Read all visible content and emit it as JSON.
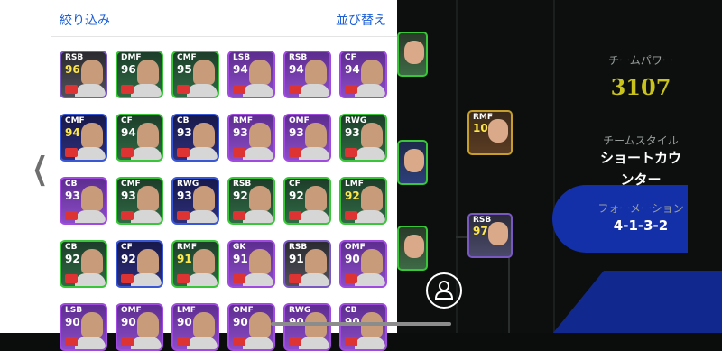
{
  "header": {
    "filter_label": "絞り込み",
    "sort_label": "並び替え"
  },
  "cards": [
    {
      "pos": "RSB",
      "ovr": "96",
      "style": "c-dark",
      "gold": true
    },
    {
      "pos": "DMF",
      "ovr": "96",
      "style": "c-green",
      "gold": false
    },
    {
      "pos": "CMF",
      "ovr": "95",
      "style": "c-green",
      "gold": false
    },
    {
      "pos": "LSB",
      "ovr": "94",
      "style": "c-purple",
      "gold": false
    },
    {
      "pos": "RSB",
      "ovr": "94",
      "style": "c-purple",
      "gold": false
    },
    {
      "pos": "CF",
      "ovr": "94",
      "style": "c-purple",
      "gold": false
    },
    {
      "pos": "CMF",
      "ovr": "94",
      "style": "c-blue",
      "gold": true
    },
    {
      "pos": "CF",
      "ovr": "94",
      "style": "c-green",
      "gold": false
    },
    {
      "pos": "CB",
      "ovr": "93",
      "style": "c-blue",
      "gold": false
    },
    {
      "pos": "RMF",
      "ovr": "93",
      "style": "c-purple",
      "gold": false
    },
    {
      "pos": "OMF",
      "ovr": "93",
      "style": "c-purple",
      "gold": false
    },
    {
      "pos": "RWG",
      "ovr": "93",
      "style": "c-green",
      "gold": false
    },
    {
      "pos": "CB",
      "ovr": "93",
      "style": "c-purple",
      "gold": false
    },
    {
      "pos": "CMF",
      "ovr": "93",
      "style": "c-green",
      "gold": false
    },
    {
      "pos": "RWG",
      "ovr": "93",
      "style": "c-blue",
      "gold": false
    },
    {
      "pos": "RSB",
      "ovr": "92",
      "style": "c-green",
      "gold": false
    },
    {
      "pos": "CF",
      "ovr": "92",
      "style": "c-green",
      "gold": false
    },
    {
      "pos": "LMF",
      "ovr": "92",
      "style": "c-green",
      "gold": true
    },
    {
      "pos": "CB",
      "ovr": "92",
      "style": "c-green",
      "gold": false
    },
    {
      "pos": "CF",
      "ovr": "92",
      "style": "c-blue",
      "gold": false
    },
    {
      "pos": "RMF",
      "ovr": "91",
      "style": "c-green",
      "gold": true
    },
    {
      "pos": "GK",
      "ovr": "91",
      "style": "c-purple",
      "gold": false
    },
    {
      "pos": "RSB",
      "ovr": "91",
      "style": "c-dark",
      "gold": false
    },
    {
      "pos": "OMF",
      "ovr": "90",
      "style": "c-purple",
      "gold": false
    },
    {
      "pos": "LSB",
      "ovr": "90",
      "style": "c-purple",
      "gold": false
    },
    {
      "pos": "OMF",
      "ovr": "90",
      "style": "c-purple",
      "gold": false
    },
    {
      "pos": "LMF",
      "ovr": "90",
      "style": "c-purple",
      "gold": false
    },
    {
      "pos": "OMF",
      "ovr": "90",
      "style": "c-purple",
      "gold": false
    },
    {
      "pos": "RWG",
      "ovr": "90",
      "style": "c-purple",
      "gold": false
    },
    {
      "pos": "CB",
      "ovr": "90",
      "style": "c-purple",
      "gold": false
    }
  ],
  "field_cards": [
    {
      "pos": "RMF",
      "ovr": "102"
    },
    {
      "pos": "RSB",
      "ovr": "97"
    }
  ],
  "team": {
    "power_label": "チームパワー",
    "power_value": "3107",
    "style_label": "チームスタイル",
    "style_value_1": "ショートカウ",
    "style_value_2": "ンター",
    "formation_label": "フォーメーション",
    "formation_value": "4-1-3-2"
  }
}
